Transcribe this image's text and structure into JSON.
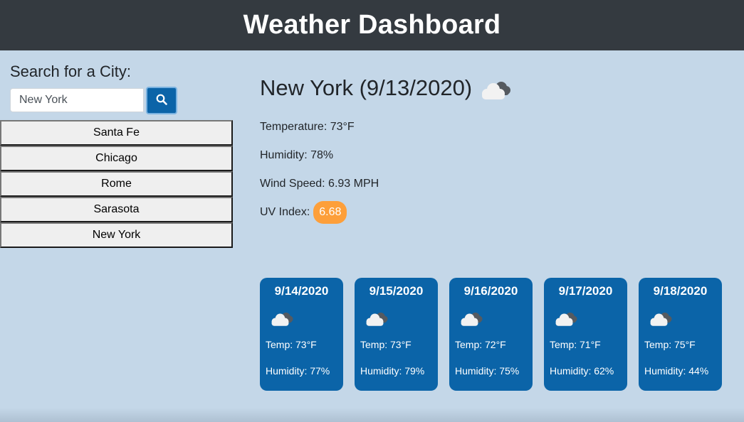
{
  "header": {
    "title": "Weather Dashboard"
  },
  "sidebar": {
    "title": "Search for a City:",
    "search": {
      "value": "New York",
      "placeholder": ""
    },
    "search_button_icon": "search-icon",
    "history": [
      {
        "label": "Santa Fe"
      },
      {
        "label": "Chicago"
      },
      {
        "label": "Rome"
      },
      {
        "label": "Sarasota"
      },
      {
        "label": "New York"
      }
    ]
  },
  "current": {
    "heading": "New York (9/13/2020)",
    "icon": "cloudy-icon",
    "temperature": "Temperature: 73°F",
    "humidity": "Humidity: 78%",
    "wind": "Wind Speed: 6.93 MPH",
    "uv_label": "UV Index:",
    "uv_value": "6.68",
    "uv_color": "#fd9f3a"
  },
  "forecast": [
    {
      "date": "9/14/2020",
      "icon": "cloudy-icon",
      "temp": "Temp: 73°F",
      "humidity": "Humidity: 77%"
    },
    {
      "date": "9/15/2020",
      "icon": "cloudy-icon",
      "temp": "Temp: 73°F",
      "humidity": "Humidity: 79%"
    },
    {
      "date": "9/16/2020",
      "icon": "cloudy-icon",
      "temp": "Temp: 72°F",
      "humidity": "Humidity: 75%"
    },
    {
      "date": "9/17/2020",
      "icon": "cloudy-icon",
      "temp": "Temp: 71°F",
      "humidity": "Humidity: 62%"
    },
    {
      "date": "9/18/2020",
      "icon": "cloudy-icon",
      "temp": "Temp: 75°F",
      "humidity": "Humidity: 44%"
    }
  ],
  "colors": {
    "header_bg": "#343a40",
    "page_bg": "#c4d7e8",
    "card_bg": "#0b64a8",
    "uv_badge": "#fd9f3a"
  }
}
